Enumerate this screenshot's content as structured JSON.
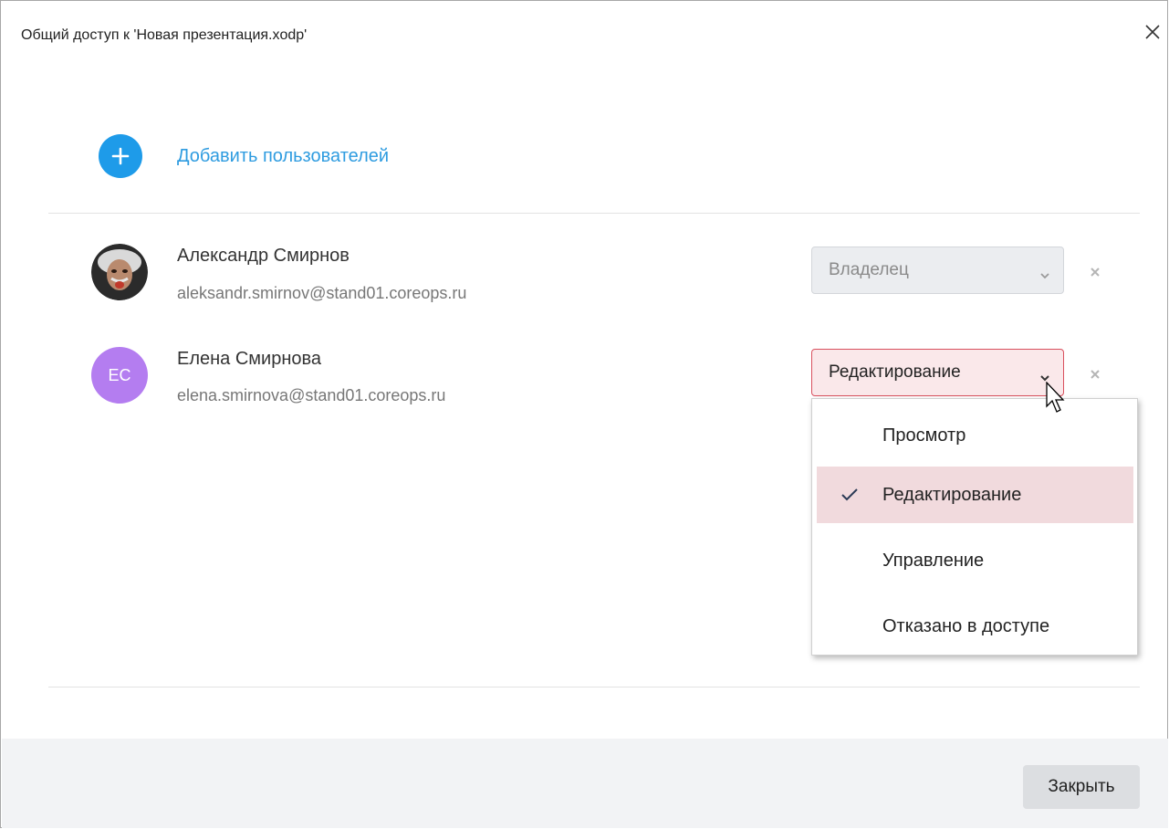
{
  "dialog": {
    "title": "Общий доступ к 'Новая презентация.xodp'",
    "close_icon": "close-icon"
  },
  "add_users": {
    "label": "Добавить пользователей",
    "icon": "plus-circle-icon",
    "color": "#1e9be9"
  },
  "users": [
    {
      "name": "Александр Смирнов",
      "email": "aleksandr.smirnov@stand01.coreops.ru",
      "avatar": "photo-avatar",
      "role": "Владелец",
      "role_disabled": true
    },
    {
      "name": "Елена Смирнова",
      "email": "elena.smirnova@stand01.coreops.ru",
      "initials": "ЕС",
      "avatar_color": "#b47df0",
      "role": "Редактирование",
      "role_disabled": false
    }
  ],
  "role_dropdown": {
    "options": [
      "Просмотр",
      "Редактирование",
      "Управление",
      "Отказано в доступе"
    ],
    "selected": "Редактирование",
    "selected_color": "#f1dadd"
  },
  "footer": {
    "close_label": "Закрыть"
  }
}
